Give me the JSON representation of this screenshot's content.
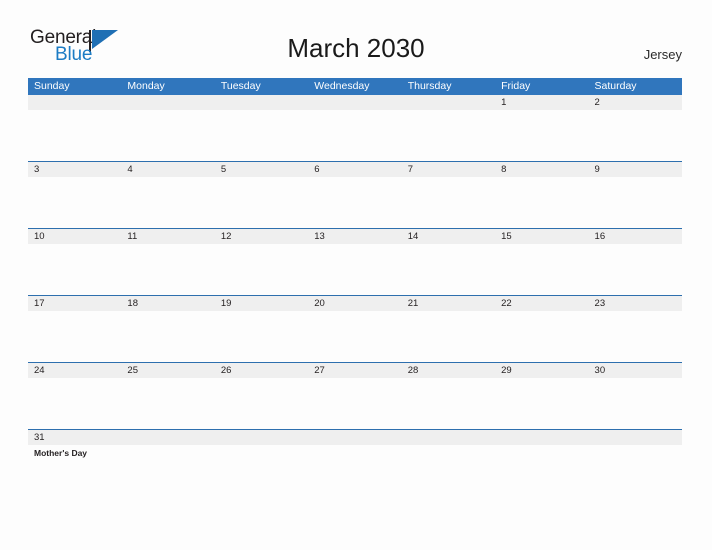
{
  "brand": {
    "word_one": "General",
    "word_two": "Blue",
    "flag_icon": "flag-icon",
    "dark_color": "#231f20",
    "blue_color": "#1b7bc4"
  },
  "header": {
    "title": "March 2030",
    "region": "Jersey"
  },
  "theme": {
    "header_blue": "#3076bd",
    "row_line_blue": "#2d6fae",
    "daynum_strip_gray": "#efefef",
    "page_background": "#fdfdfd",
    "text_color": "#231f20"
  },
  "calendar": {
    "weekdays": [
      "Sunday",
      "Monday",
      "Tuesday",
      "Wednesday",
      "Thursday",
      "Friday",
      "Saturday"
    ],
    "weeks": [
      {
        "days": [
          {
            "num": "",
            "events": []
          },
          {
            "num": "",
            "events": []
          },
          {
            "num": "",
            "events": []
          },
          {
            "num": "",
            "events": []
          },
          {
            "num": "",
            "events": []
          },
          {
            "num": "1",
            "events": []
          },
          {
            "num": "2",
            "events": []
          }
        ]
      },
      {
        "days": [
          {
            "num": "3",
            "events": []
          },
          {
            "num": "4",
            "events": []
          },
          {
            "num": "5",
            "events": []
          },
          {
            "num": "6",
            "events": []
          },
          {
            "num": "7",
            "events": []
          },
          {
            "num": "8",
            "events": []
          },
          {
            "num": "9",
            "events": []
          }
        ]
      },
      {
        "days": [
          {
            "num": "10",
            "events": []
          },
          {
            "num": "11",
            "events": []
          },
          {
            "num": "12",
            "events": []
          },
          {
            "num": "13",
            "events": []
          },
          {
            "num": "14",
            "events": []
          },
          {
            "num": "15",
            "events": []
          },
          {
            "num": "16",
            "events": []
          }
        ]
      },
      {
        "days": [
          {
            "num": "17",
            "events": []
          },
          {
            "num": "18",
            "events": []
          },
          {
            "num": "19",
            "events": []
          },
          {
            "num": "20",
            "events": []
          },
          {
            "num": "21",
            "events": []
          },
          {
            "num": "22",
            "events": []
          },
          {
            "num": "23",
            "events": []
          }
        ]
      },
      {
        "days": [
          {
            "num": "24",
            "events": []
          },
          {
            "num": "25",
            "events": []
          },
          {
            "num": "26",
            "events": []
          },
          {
            "num": "27",
            "events": []
          },
          {
            "num": "28",
            "events": []
          },
          {
            "num": "29",
            "events": []
          },
          {
            "num": "30",
            "events": []
          }
        ]
      },
      {
        "days": [
          {
            "num": "31",
            "events": [
              "Mother's Day"
            ]
          },
          {
            "num": "",
            "events": []
          },
          {
            "num": "",
            "events": []
          },
          {
            "num": "",
            "events": []
          },
          {
            "num": "",
            "events": []
          },
          {
            "num": "",
            "events": []
          },
          {
            "num": "",
            "events": []
          }
        ]
      }
    ]
  }
}
